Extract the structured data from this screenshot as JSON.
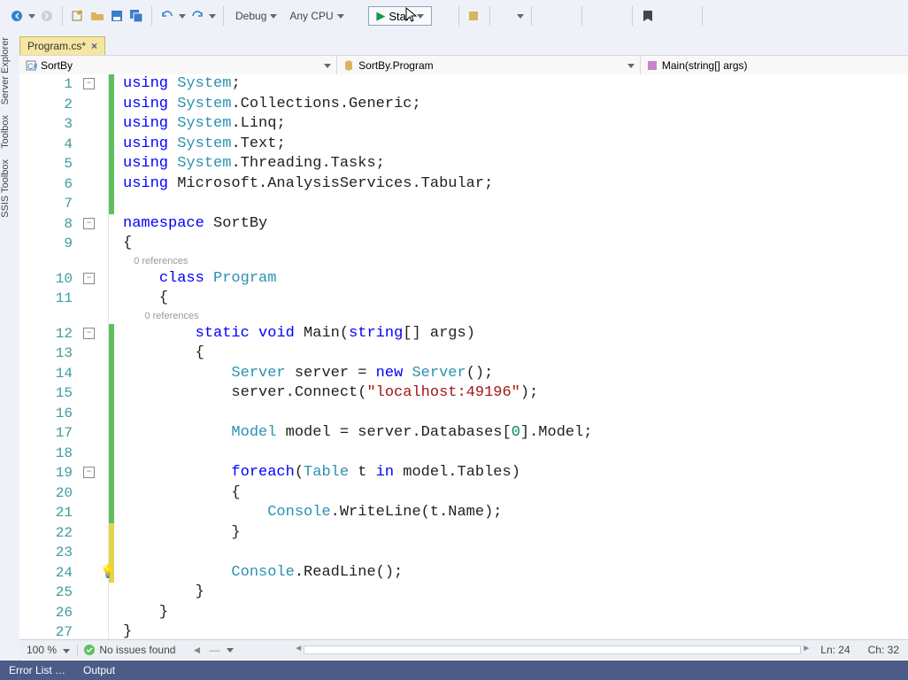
{
  "toolbar": {
    "config": "Debug",
    "platform": "Any CPU",
    "start": "Start"
  },
  "leftTabs": [
    "Server Explorer",
    "Toolbox",
    "SSIS Toolbox"
  ],
  "docTab": {
    "label": "Program.cs*"
  },
  "nav": {
    "scope": "SortBy",
    "type": "SortBy.Program",
    "member": "Main(string[] args)"
  },
  "codelens": {
    "refs": "0 references"
  },
  "lines": [
    {
      "n": 1,
      "mark": "green",
      "fold": true,
      "tokens": [
        [
          "kw",
          "using"
        ],
        [
          "",
          " "
        ],
        [
          "type",
          "System"
        ],
        [
          "",
          ";"
        ]
      ]
    },
    {
      "n": 2,
      "mark": "green",
      "tokens": [
        [
          "kw",
          "using"
        ],
        [
          "",
          " "
        ],
        [
          "type",
          "System"
        ],
        [
          "",
          ".Collections.Generic;"
        ]
      ]
    },
    {
      "n": 3,
      "mark": "green",
      "tokens": [
        [
          "kw",
          "using"
        ],
        [
          "",
          " "
        ],
        [
          "type",
          "System"
        ],
        [
          "",
          ".Linq;"
        ]
      ]
    },
    {
      "n": 4,
      "mark": "green",
      "tokens": [
        [
          "kw",
          "using"
        ],
        [
          "",
          " "
        ],
        [
          "type",
          "System"
        ],
        [
          "",
          ".Text;"
        ]
      ]
    },
    {
      "n": 5,
      "mark": "green",
      "tokens": [
        [
          "kw",
          "using"
        ],
        [
          "",
          " "
        ],
        [
          "type",
          "System"
        ],
        [
          "",
          ".Threading.Tasks;"
        ]
      ]
    },
    {
      "n": 6,
      "mark": "green",
      "tokens": [
        [
          "kw",
          "using"
        ],
        [
          "",
          " Microsoft.AnalysisServices.Tabular;"
        ]
      ]
    },
    {
      "n": 7,
      "mark": "green",
      "tokens": [
        [
          "",
          ""
        ]
      ]
    },
    {
      "n": 8,
      "mark": "",
      "fold": true,
      "tokens": [
        [
          "kw",
          "namespace"
        ],
        [
          "",
          " SortBy"
        ]
      ]
    },
    {
      "n": 9,
      "mark": "",
      "tokens": [
        [
          "",
          "{"
        ]
      ]
    },
    {
      "codelens": true,
      "indent": "    "
    },
    {
      "n": 10,
      "mark": "",
      "fold": true,
      "tokens": [
        [
          "",
          "    "
        ],
        [
          "kw",
          "class"
        ],
        [
          "",
          " "
        ],
        [
          "type",
          "Program"
        ]
      ]
    },
    {
      "n": 11,
      "mark": "",
      "tokens": [
        [
          "",
          "    {"
        ]
      ]
    },
    {
      "codelens": true,
      "indent": "        "
    },
    {
      "n": 12,
      "mark": "green",
      "fold": true,
      "tokens": [
        [
          "",
          "        "
        ],
        [
          "kw",
          "static"
        ],
        [
          "",
          " "
        ],
        [
          "kw",
          "void"
        ],
        [
          "",
          " "
        ],
        [
          "",
          "Main"
        ],
        [
          "",
          "("
        ],
        [
          "kw",
          "string"
        ],
        [
          "",
          "[] "
        ],
        [
          "",
          "args"
        ],
        [
          "",
          ")"
        ]
      ]
    },
    {
      "n": 13,
      "mark": "green",
      "tokens": [
        [
          "",
          "        {"
        ]
      ]
    },
    {
      "n": 14,
      "mark": "green",
      "tokens": [
        [
          "",
          "            "
        ],
        [
          "type",
          "Server"
        ],
        [
          "",
          " server = "
        ],
        [
          "kw",
          "new"
        ],
        [
          "",
          " "
        ],
        [
          "type",
          "Server"
        ],
        [
          "",
          "();"
        ]
      ]
    },
    {
      "n": 15,
      "mark": "green",
      "tokens": [
        [
          "",
          "            server."
        ],
        [
          "",
          "Connect"
        ],
        [
          "",
          "("
        ],
        [
          "str",
          "\"localhost:49196\""
        ],
        [
          "",
          ");"
        ]
      ]
    },
    {
      "n": 16,
      "mark": "green",
      "tokens": [
        [
          "",
          ""
        ]
      ]
    },
    {
      "n": 17,
      "mark": "green",
      "tokens": [
        [
          "",
          "            "
        ],
        [
          "type",
          "Model"
        ],
        [
          "",
          " model = server.Databases["
        ],
        [
          "num",
          "0"
        ],
        [
          "",
          "].Model;"
        ]
      ]
    },
    {
      "n": 18,
      "mark": "green",
      "tokens": [
        [
          "",
          ""
        ]
      ]
    },
    {
      "n": 19,
      "mark": "green",
      "fold": true,
      "tokens": [
        [
          "",
          "            "
        ],
        [
          "kw",
          "foreach"
        ],
        [
          "",
          "("
        ],
        [
          "type",
          "Table"
        ],
        [
          "",
          " t "
        ],
        [
          "kw",
          "in"
        ],
        [
          "",
          " model.Tables)"
        ]
      ]
    },
    {
      "n": 20,
      "mark": "green",
      "tokens": [
        [
          "",
          "            {"
        ]
      ]
    },
    {
      "n": 21,
      "mark": "green",
      "tokens": [
        [
          "",
          "                "
        ],
        [
          "type",
          "Console"
        ],
        [
          "",
          ".WriteLine(t.Name);"
        ]
      ]
    },
    {
      "n": 22,
      "mark": "yellow",
      "tokens": [
        [
          "",
          "            }"
        ]
      ]
    },
    {
      "n": 23,
      "mark": "yellow",
      "tokens": [
        [
          "",
          ""
        ]
      ]
    },
    {
      "n": 24,
      "mark": "yellow",
      "bulb": true,
      "tokens": [
        [
          "",
          "            "
        ],
        [
          "type",
          "Console"
        ],
        [
          "",
          ".ReadLine();"
        ]
      ]
    },
    {
      "n": 25,
      "mark": "",
      "tokens": [
        [
          "",
          "        }"
        ]
      ]
    },
    {
      "n": 26,
      "mark": "",
      "tokens": [
        [
          "",
          "    }"
        ]
      ]
    },
    {
      "n": 27,
      "mark": "",
      "tokens": [
        [
          "",
          "}"
        ]
      ]
    }
  ],
  "status": {
    "zoom": "100 %",
    "issues": "No issues found",
    "line": "Ln: 24",
    "col": "Ch: 32"
  },
  "bottomTabs": [
    "Error List …",
    "Output"
  ]
}
